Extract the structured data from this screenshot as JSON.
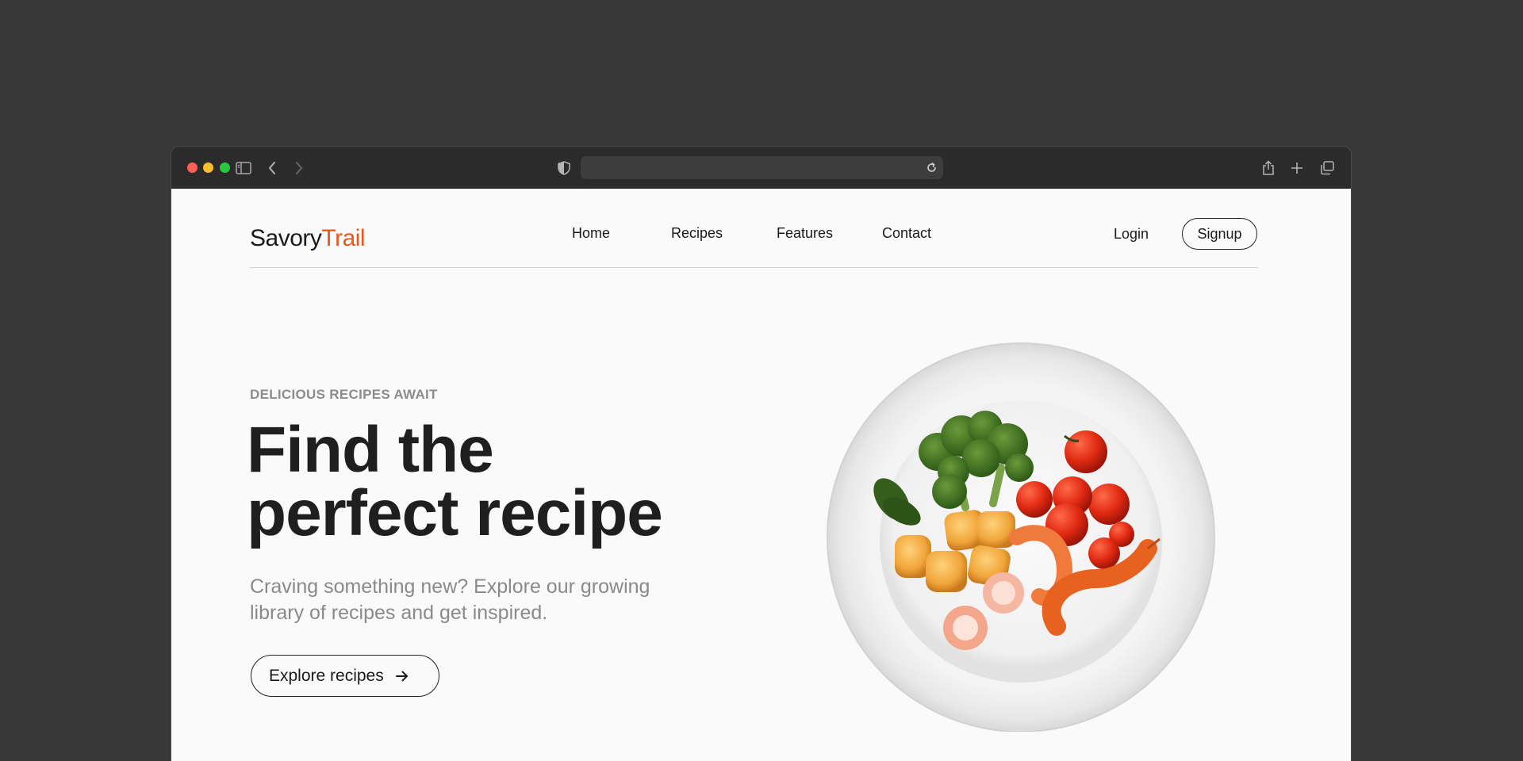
{
  "browser": {
    "address_text": ""
  },
  "site": {
    "logo": {
      "part1": "Savory",
      "part2": "Trail",
      "accent_color": "#e8571e"
    },
    "nav": [
      {
        "label": "Home"
      },
      {
        "label": "Recipes"
      },
      {
        "label": "Features"
      },
      {
        "label": "Contact"
      }
    ],
    "auth": {
      "login_label": "Login",
      "signup_label": "Signup"
    }
  },
  "hero": {
    "eyebrow": "DELICIOUS RECIPES AWAIT",
    "headline_line1": "Find the",
    "headline_line2": "perfect recipe",
    "subtext_line1": "Craving something new? Explore our growing",
    "subtext_line2": "library of recipes and get inspired.",
    "cta_label": "Explore recipes",
    "cta_icon": "arrow-right-icon",
    "image": "plate-of-broccoli-tomatoes-shrimp-and-fried-tofu"
  },
  "icons": {
    "sidebar": "sidebar-toggle-icon",
    "back": "chevron-left-icon",
    "forward": "chevron-right-icon",
    "privacy": "shield-icon",
    "reload": "reload-icon",
    "share": "share-icon",
    "new_tab": "plus-icon",
    "tabs": "tab-overview-icon"
  }
}
